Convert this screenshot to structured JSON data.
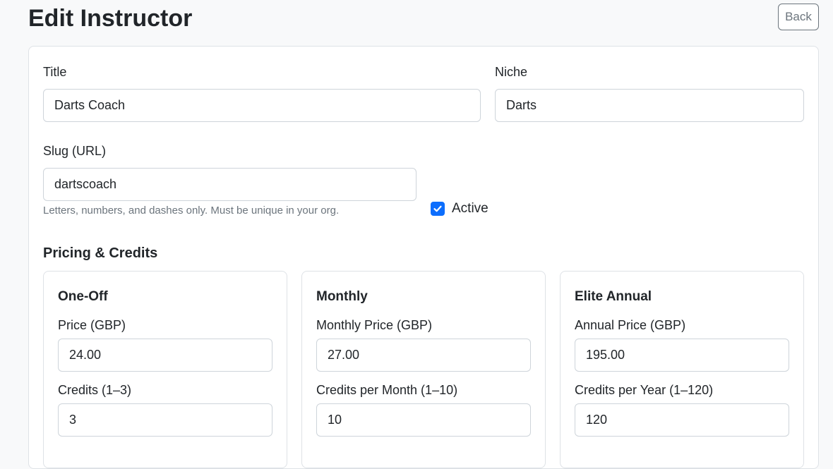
{
  "header": {
    "title": "Edit Instructor",
    "back_label": "Back"
  },
  "form": {
    "title_label": "Title",
    "title_value": "Darts Coach",
    "niche_label": "Niche",
    "niche_value": "Darts",
    "slug_label": "Slug (URL)",
    "slug_value": "dartscoach",
    "slug_help": "Letters, numbers, and dashes only. Must be unique in your org.",
    "active_label": "Active",
    "active_checked": true
  },
  "pricing": {
    "heading": "Pricing & Credits",
    "plans": [
      {
        "title": "One-Off",
        "price_label": "Price (GBP)",
        "price_value": "24.00",
        "credits_label": "Credits (1–3)",
        "credits_value": "3"
      },
      {
        "title": "Monthly",
        "price_label": "Monthly Price (GBP)",
        "price_value": "27.00",
        "credits_label": "Credits per Month (1–10)",
        "credits_value": "10"
      },
      {
        "title": "Elite Annual",
        "price_label": "Annual Price (GBP)",
        "price_value": "195.00",
        "credits_label": "Credits per Year (1–120)",
        "credits_value": "120"
      }
    ]
  },
  "colors": {
    "accent": "#0d6efd",
    "border": "#dee2e6",
    "muted_text": "#6c757d"
  },
  "icons": {
    "checkbox": "check-icon"
  }
}
